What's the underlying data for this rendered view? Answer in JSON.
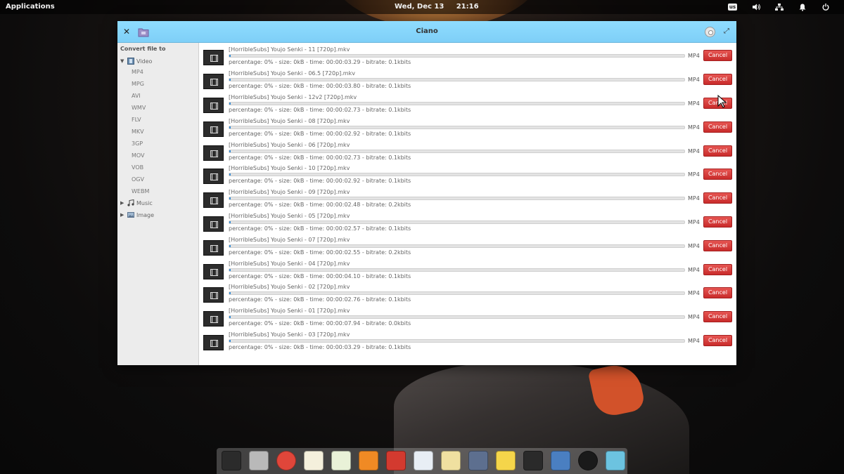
{
  "top_panel": {
    "applications": "Applications",
    "clock": "Wed, Dec 13     21:16",
    "keyboard_layout": "us"
  },
  "window": {
    "title": "Ciano"
  },
  "sidebar": {
    "heading": "Convert file to",
    "video_label": "Video",
    "video_formats": [
      "MP4",
      "MPG",
      "AVI",
      "WMV",
      "FLV",
      "MKV",
      "3GP",
      "MOV",
      "VOB",
      "OGV",
      "WEBM"
    ],
    "music_label": "Music",
    "image_label": "Image"
  },
  "jobs": [
    {
      "file": "[HorribleSubs] Youjo Senki - 11 [720p].mkv",
      "status": "percentage: 0% - size: 0kB - time: 00:00:03.29 - bitrate: 0.1kbits",
      "format": "MP4",
      "cancel": "Cancel"
    },
    {
      "file": "[HorribleSubs] Youjo Senki - 06.5 [720p].mkv",
      "status": "percentage: 0% - size: 0kB - time: 00:00:03.80 - bitrate: 0.1kbits",
      "format": "MP4",
      "cancel": "Cancel"
    },
    {
      "file": "[HorribleSubs] Youjo Senki - 12v2 [720p].mkv",
      "status": "percentage: 0% - size: 0kB - time: 00:00:02.73 - bitrate: 0.1kbits",
      "format": "MP4",
      "cancel": "Cancel"
    },
    {
      "file": "[HorribleSubs] Youjo Senki - 08 [720p].mkv",
      "status": "percentage: 0% - size: 0kB - time: 00:00:02.92 - bitrate: 0.1kbits",
      "format": "MP4",
      "cancel": "Cancel"
    },
    {
      "file": "[HorribleSubs] Youjo Senki - 06 [720p].mkv",
      "status": "percentage: 0% - size: 0kB - time: 00:00:02.73 - bitrate: 0.1kbits",
      "format": "MP4",
      "cancel": "Cancel"
    },
    {
      "file": "[HorribleSubs] Youjo Senki - 10 [720p].mkv",
      "status": "percentage: 0% - size: 0kB - time: 00:00:02.92 - bitrate: 0.1kbits",
      "format": "MP4",
      "cancel": "Cancel"
    },
    {
      "file": "[HorribleSubs] Youjo Senki - 09 [720p].mkv",
      "status": "percentage: 0% - size: 0kB - time: 00:00:02.48 - bitrate: 0.2kbits",
      "format": "MP4",
      "cancel": "Cancel"
    },
    {
      "file": "[HorribleSubs] Youjo Senki - 05 [720p].mkv",
      "status": "percentage: 0% - size: 0kB - time: 00:00:02.57 - bitrate: 0.1kbits",
      "format": "MP4",
      "cancel": "Cancel"
    },
    {
      "file": "[HorribleSubs] Youjo Senki - 07 [720p].mkv",
      "status": "percentage: 0% - size: 0kB - time: 00:00:02.55 - bitrate: 0.2kbits",
      "format": "MP4",
      "cancel": "Cancel"
    },
    {
      "file": "[HorribleSubs] Youjo Senki - 04 [720p].mkv",
      "status": "percentage: 0% - size: 0kB - time: 00:00:04.10 - bitrate: 0.1kbits",
      "format": "MP4",
      "cancel": "Cancel"
    },
    {
      "file": "[HorribleSubs] Youjo Senki - 02 [720p].mkv",
      "status": "percentage: 0% - size: 0kB - time: 00:00:02.76 - bitrate: 0.1kbits",
      "format": "MP4",
      "cancel": "Cancel"
    },
    {
      "file": "[HorribleSubs] Youjo Senki - 01 [720p].mkv",
      "status": "percentage: 0% - size: 0kB - time: 00:00:07.94 - bitrate: 0.0kbits",
      "format": "MP4",
      "cancel": "Cancel"
    },
    {
      "file": "[HorribleSubs] Youjo Senki - 03 [720p].mkv",
      "status": "percentage: 0% - size: 0kB - time: 00:00:03.29 - bitrate: 0.1kbits",
      "format": "MP4",
      "cancel": "Cancel"
    }
  ],
  "dock": {
    "items": [
      {
        "icon": "terminal-icon",
        "color": "#2b2b2b"
      },
      {
        "icon": "files-icon",
        "color": "#b9b9b9"
      },
      {
        "icon": "chrome-icon",
        "color": "#e0463a"
      },
      {
        "icon": "code-editor-icon",
        "color": "#f4f0dc"
      },
      {
        "icon": "spreadsheet-icon",
        "color": "#e9f2d8"
      },
      {
        "icon": "music-icon",
        "color": "#f08a24"
      },
      {
        "icon": "video-player-icon",
        "color": "#d33a2f"
      },
      {
        "icon": "settings-toggle-icon",
        "color": "#e8eef5"
      },
      {
        "icon": "mail-icon",
        "color": "#f0e0a0"
      },
      {
        "icon": "appcenter-icon",
        "color": "#5d6f8f"
      },
      {
        "icon": "notes-icon",
        "color": "#f5d54a"
      },
      {
        "icon": "screencast-icon",
        "color": "#2a2a2a"
      },
      {
        "icon": "converter-icon",
        "color": "#4a7fc1"
      },
      {
        "icon": "camera-icon",
        "color": "#1a1a1a"
      },
      {
        "icon": "sync-icon",
        "color": "#6cc3e0"
      }
    ]
  }
}
